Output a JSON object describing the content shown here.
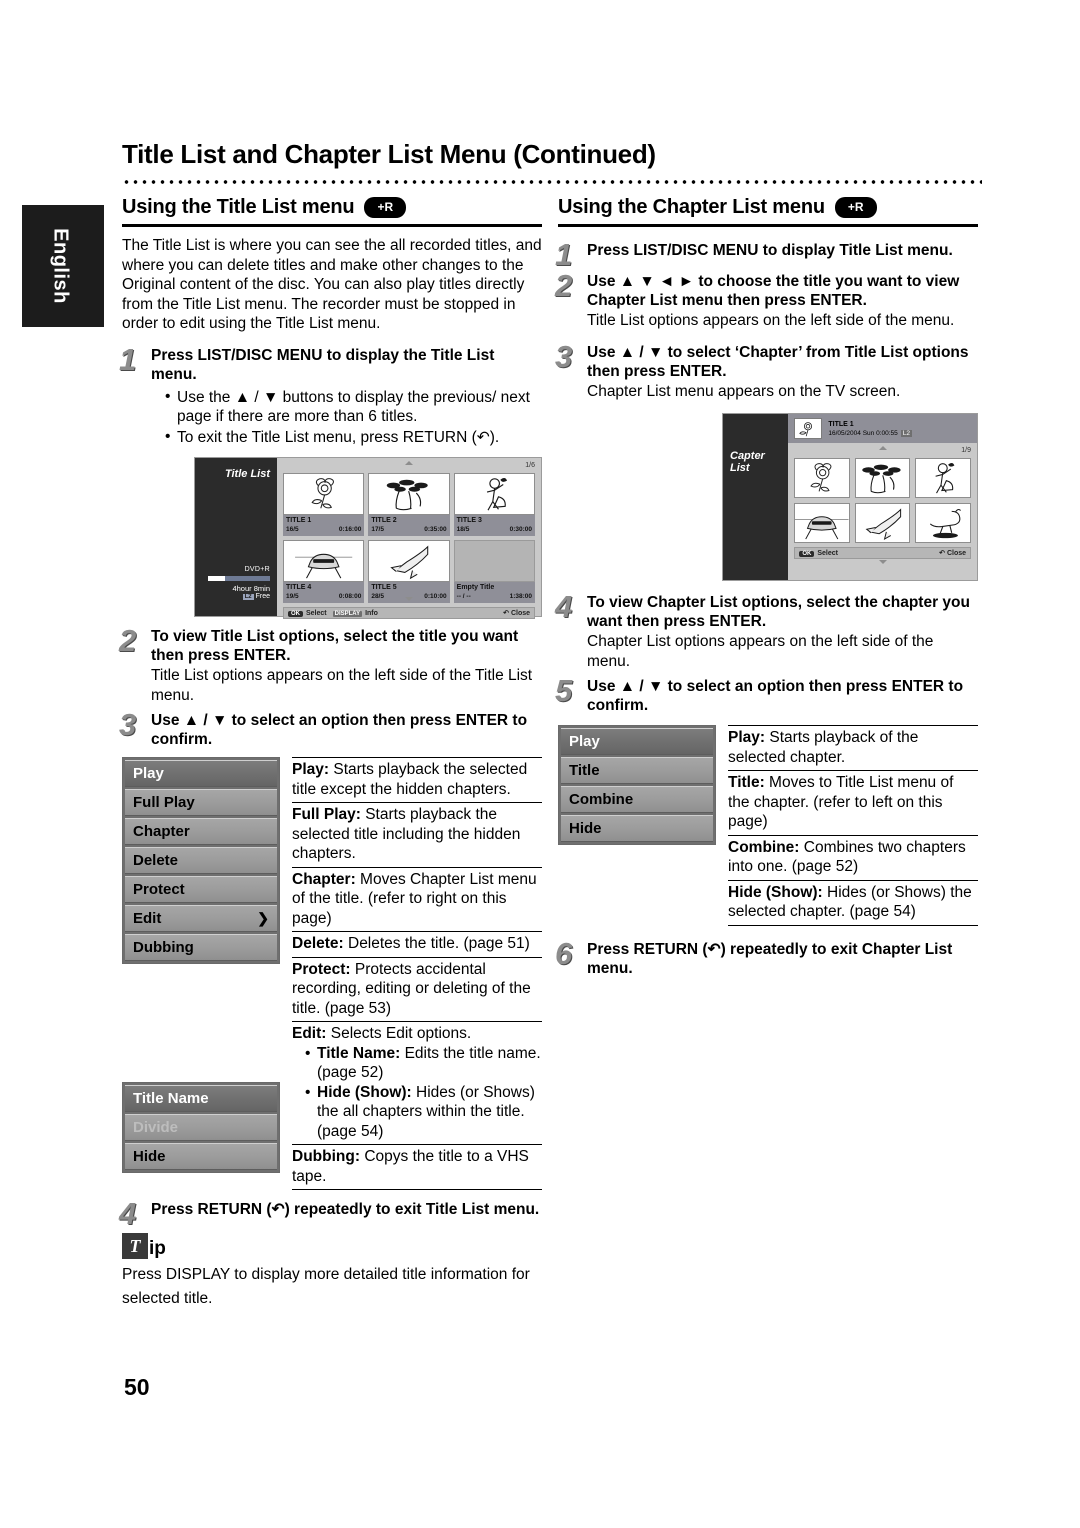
{
  "language_tab": "English",
  "page_title": "Title List and Chapter List Menu (Continued)",
  "page_number": "50",
  "badge_label": "+R",
  "left": {
    "section_title": "Using the Title List menu",
    "intro": "The Title List is where you can see the all recorded titles, and where you can delete titles and make other changes to the Original content of the disc. You can also play titles directly from the Title List menu. The recorder must be stopped in order to edit using the Title List menu.",
    "steps": [
      {
        "num": "1",
        "lead": "Press LIST/DISC MENU to display the Title List menu.",
        "bullets": [
          "Use the ▲ / ▼ buttons to display the previous/ next page if there are more than 6 titles.",
          "To exit the Title List menu, press RETURN (↶)."
        ]
      },
      {
        "num": "2",
        "lead": "To view Title List options, select the title you want then press ENTER.",
        "sub": "Title List options appears on the left side of the Title List menu."
      },
      {
        "num": "3",
        "lead": "Use ▲ / ▼ to select an option then press ENTER to confirm."
      },
      {
        "num": "4",
        "lead": "Press RETURN (↶) repeatedly to exit Title List menu."
      }
    ],
    "options_menu": [
      {
        "label": "Play",
        "state": "selected"
      },
      {
        "label": "Full Play",
        "state": "normal"
      },
      {
        "label": "Chapter",
        "state": "normal"
      },
      {
        "label": "Delete",
        "state": "normal"
      },
      {
        "label": "Protect",
        "state": "normal"
      },
      {
        "label": "Edit",
        "state": "normal",
        "chevron": "❯"
      },
      {
        "label": "Dubbing",
        "state": "normal"
      }
    ],
    "edit_submenu": [
      {
        "label": "Title Name",
        "state": "selected"
      },
      {
        "label": "Divide",
        "state": "dim"
      },
      {
        "label": "Hide",
        "state": "normal"
      }
    ],
    "definitions": [
      {
        "term": "Play:",
        "text": " Starts playback the selected title except the hidden chapters."
      },
      {
        "term": "Full Play:",
        "text": " Starts playback the selected title including the hidden chapters."
      },
      {
        "term": "Chapter:",
        "text": " Moves Chapter List menu of the title. (refer to right on this page)"
      },
      {
        "term": "Delete:",
        "text": " Deletes the title. (page 51)"
      },
      {
        "term": "Protect:",
        "text": " Protects accidental recording, editing or deleting of the title. (page 53)"
      },
      {
        "term": "Edit:",
        "text": " Selects Edit options.",
        "subitems": [
          {
            "term": "Title Name:",
            "text": " Edits the title name. (page 52)"
          },
          {
            "term": "Hide (Show):",
            "text": " Hides (or Shows) the all chapters within the title. (page 54)"
          }
        ]
      },
      {
        "term": "Dubbing:",
        "text": " Copys the title to a VHS tape."
      }
    ],
    "tip": {
      "box_letter": "T",
      "suffix": "ip",
      "text": "Press DISPLAY to display more detailed title information for selected title."
    },
    "osd": {
      "side_title": "Title List",
      "disc_type": "DVD+R",
      "free_time": "4hour 8min",
      "free_label": "Free",
      "free_tag": "L2",
      "page_indicator": "1/6",
      "titles": [
        {
          "name": "TITLE 1",
          "date": "16/5",
          "length": "0:16:00",
          "art": "rose"
        },
        {
          "name": "TITLE 2",
          "date": "17/5",
          "length": "0:35:00",
          "art": "dancers"
        },
        {
          "name": "TITLE 3",
          "date": "18/5",
          "length": "0:30:00",
          "art": "figure"
        },
        {
          "name": "TITLE 4",
          "date": "19/5",
          "length": "0:08:00",
          "art": "car"
        },
        {
          "name": "TITLE 5",
          "date": "28/5",
          "length": "0:10:00",
          "art": "shuttle"
        },
        {
          "name": "Empty Title",
          "date": "-- / --",
          "length": "1:38:00",
          "art": "empty"
        }
      ],
      "footer": {
        "ok": "OK",
        "select": "Select",
        "display": "DISPLAY",
        "info": "Info",
        "close": "Close"
      }
    }
  },
  "right": {
    "section_title": "Using the Chapter List menu",
    "steps": [
      {
        "num": "1",
        "lead": "Press LIST/DISC MENU to display Title List menu."
      },
      {
        "num": "2",
        "lead": "Use ▲ ▼ ◄ ► to choose the title you want to view Chapter List menu then press ENTER.",
        "sub": "Title List options appears on the left side of the menu."
      },
      {
        "num": "3",
        "lead": "Use ▲ / ▼ to select ‘Chapter’ from Title List options then press ENTER.",
        "sub": "Chapter List menu appears on the TV screen."
      },
      {
        "num": "4",
        "lead": "To view Chapter List options, select the chapter you want then press ENTER.",
        "sub": "Chapter List options appears on the left side of the menu."
      },
      {
        "num": "5",
        "lead": "Use ▲ / ▼ to select an option then press ENTER to confirm."
      },
      {
        "num": "6",
        "lead": "Press RETURN (↶) repeatedly to exit Chapter List menu."
      }
    ],
    "options_menu": [
      {
        "label": "Play",
        "state": "selected"
      },
      {
        "label": "Title",
        "state": "normal"
      },
      {
        "label": "Combine",
        "state": "normal"
      },
      {
        "label": "Hide",
        "state": "normal"
      }
    ],
    "definitions": [
      {
        "term": "Play:",
        "text": " Starts playback of the selected chapter."
      },
      {
        "term": "Title:",
        "text": " Moves to Title List menu of the chapter. (refer to left on this page)"
      },
      {
        "term": "Combine:",
        "text": " Combines two chapters into one. (page 52)"
      },
      {
        "term": "Hide (Show):",
        "text": " Hides (or Shows) the selected chapter. (page 54)"
      }
    ],
    "osd": {
      "side_title": "Capter List",
      "header_title": "TITLE 1",
      "header_meta": "16/05/2004 Sun 0:00:55",
      "header_tag": "L2",
      "page_indicator": "1/9",
      "chapters": [
        "rose",
        "dancers",
        "figure",
        "car",
        "shuttle",
        "dog"
      ],
      "footer": {
        "ok": "OK",
        "select": "Select",
        "close": "Close"
      }
    }
  }
}
